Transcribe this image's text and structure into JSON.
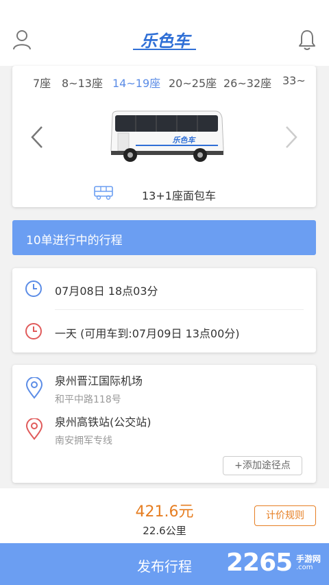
{
  "header": {
    "logo_text": "乐色车",
    "user_icon": "user-icon",
    "bell_icon": "bell-icon"
  },
  "seat_selector": {
    "tabs": [
      "7座",
      "8~13座",
      "14~19座",
      "20~25座",
      "26~32座",
      "33~"
    ],
    "selected_index": 2,
    "vehicle_name": "13+1座面包车",
    "bus_livery_text": "乐色车",
    "prev_icon": "chevron-left-icon",
    "next_icon": "chevron-right-icon"
  },
  "banner": {
    "text": "10单进行中的行程"
  },
  "schedule": {
    "start_time": "07月08日 18点03分",
    "duration": "一天 (可用车到:07月09日 13点00分)"
  },
  "route": {
    "origin_name": "泉州晋江国际机场",
    "origin_address": "和平中路118号",
    "destination_name": "泉州高铁站(公交站)",
    "destination_address": "南安拥军专线",
    "add_waypoint_label": "+添加途径点"
  },
  "summary": {
    "price": "421.6元",
    "distance": "22.6公里",
    "pricing_rules_label": "计价规则"
  },
  "publish": {
    "label": "发布行程"
  },
  "watermark": {
    "number": "2265",
    "name": "手游网",
    "url": ".com"
  },
  "colors": {
    "accent": "#6b9ef2",
    "active_tab": "#5b8ce6",
    "price": "#e67e22",
    "origin_icon": "#5b8ce6",
    "destination_icon": "#e05a5a"
  }
}
